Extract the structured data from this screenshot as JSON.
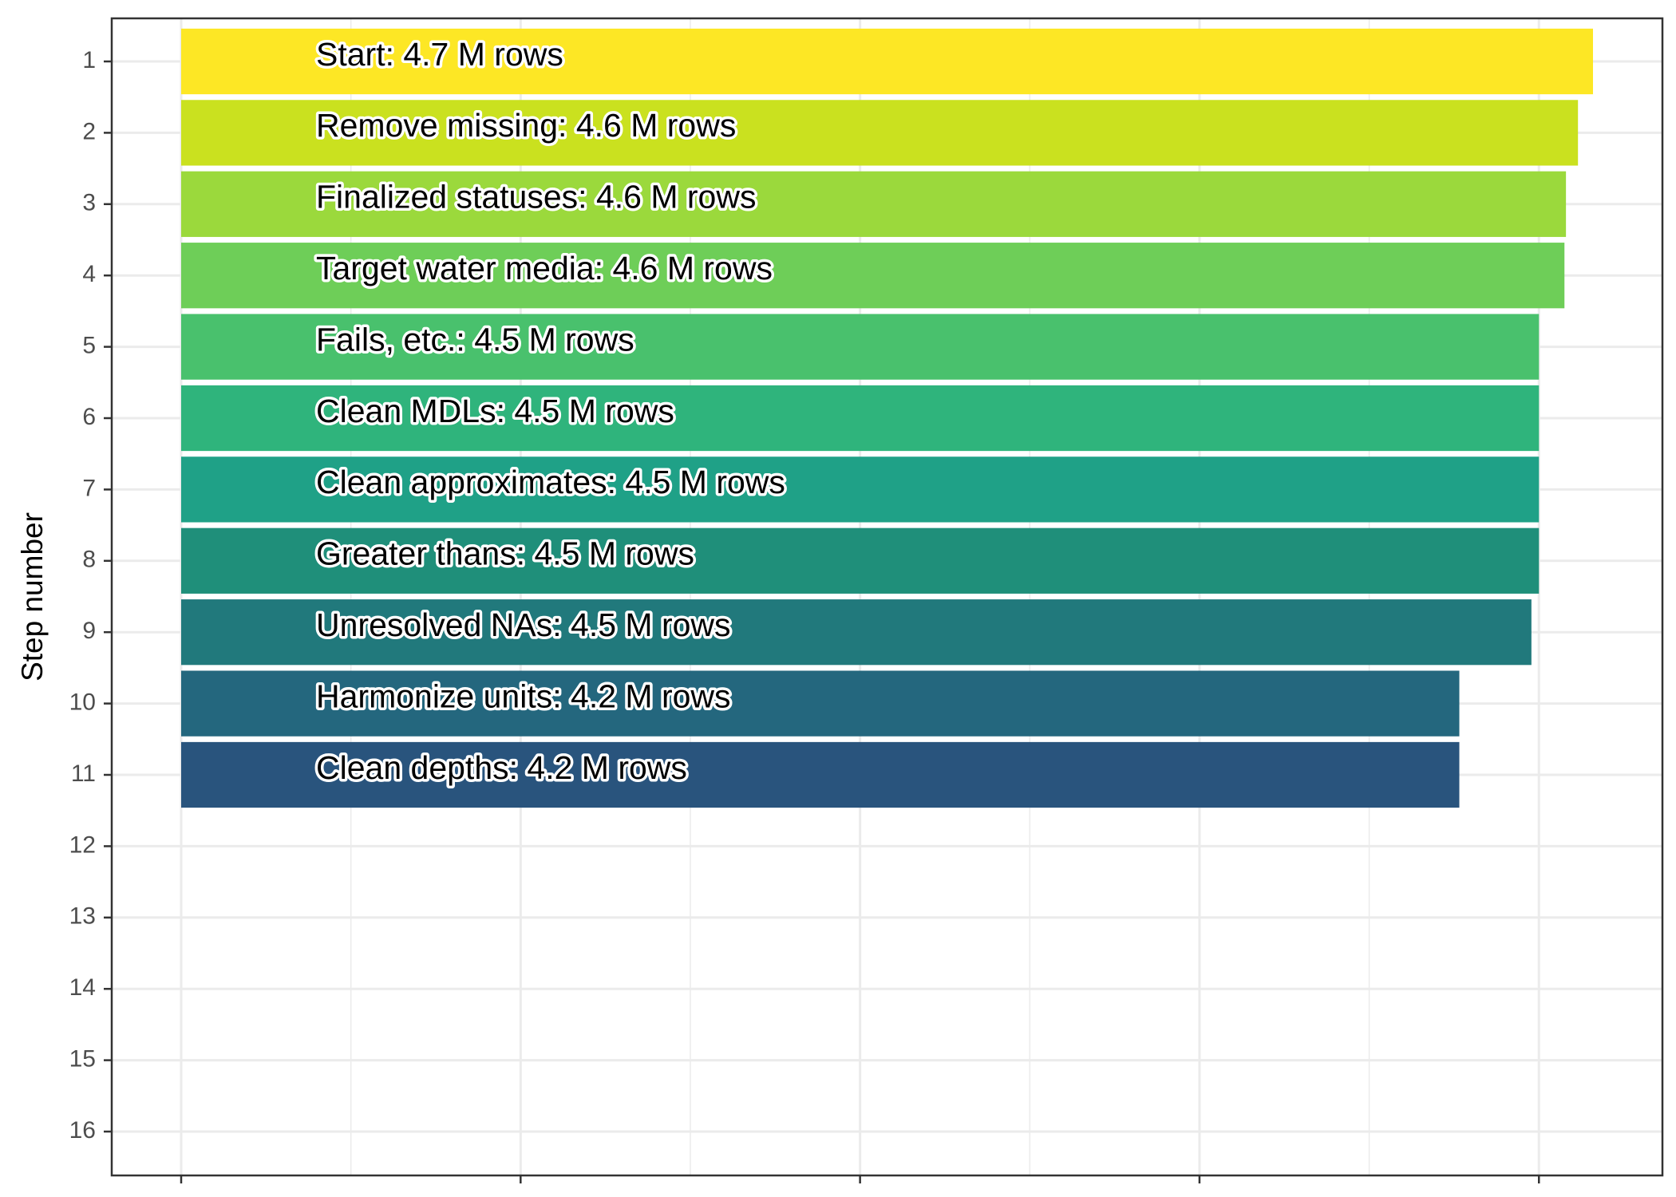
{
  "chart_data": {
    "type": "bar",
    "orientation": "horizontal",
    "ylabel": "Step number",
    "xlabel": "",
    "title": "",
    "steps": [
      {
        "step": 1,
        "label": "Start:  4.7 M rows",
        "value": 4.7,
        "color": "#FDE725"
      },
      {
        "step": 2,
        "label": "Remove missing:  4.6 M rows",
        "value": 4.65,
        "color": "#CAE11F"
      },
      {
        "step": 3,
        "label": "Finalized statuses:  4.6 M rows",
        "value": 4.61,
        "color": "#9BD93C"
      },
      {
        "step": 4,
        "label": "Target water media:  4.6 M rows",
        "value": 4.605,
        "color": "#6ECE58"
      },
      {
        "step": 5,
        "label": "Fails, etc.:  4.5 M rows",
        "value": 4.52,
        "color": "#49C16D"
      },
      {
        "step": 6,
        "label": "Clean MDLs:  4.5 M rows",
        "value": 4.52,
        "color": "#2FB47C"
      },
      {
        "step": 7,
        "label": "Clean approximates:  4.5 M rows",
        "value": 4.52,
        "color": "#1FA187"
      },
      {
        "step": 8,
        "label": "Greater thans:  4.5 M rows",
        "value": 4.52,
        "color": "#1F8F7A"
      },
      {
        "step": 9,
        "label": "Unresolved NAs:  4.5 M rows",
        "value": 4.495,
        "color": "#21797C"
      },
      {
        "step": 10,
        "label": "Harmonize units:  4.2 M rows",
        "value": 4.255,
        "color": "#24677E"
      },
      {
        "step": 11,
        "label": "Clean depths:  4.2 M rows",
        "value": 4.255,
        "color": "#29547D"
      }
    ],
    "y_ticks": [
      "1",
      "2",
      "3",
      "4",
      "5",
      "6",
      "7",
      "8",
      "9",
      "10",
      "11",
      "12",
      "13",
      "14",
      "15",
      "16"
    ],
    "y_range": [
      1,
      16
    ],
    "x_range": [
      0,
      4.7
    ],
    "x_tick_values": [
      0,
      1.13,
      2.26,
      3.39,
      4.52
    ],
    "x_tick_labels_shown": false,
    "grid": true,
    "legend": "none",
    "panel_border_color": "#333333",
    "grid_color": "#EBEBEB"
  }
}
